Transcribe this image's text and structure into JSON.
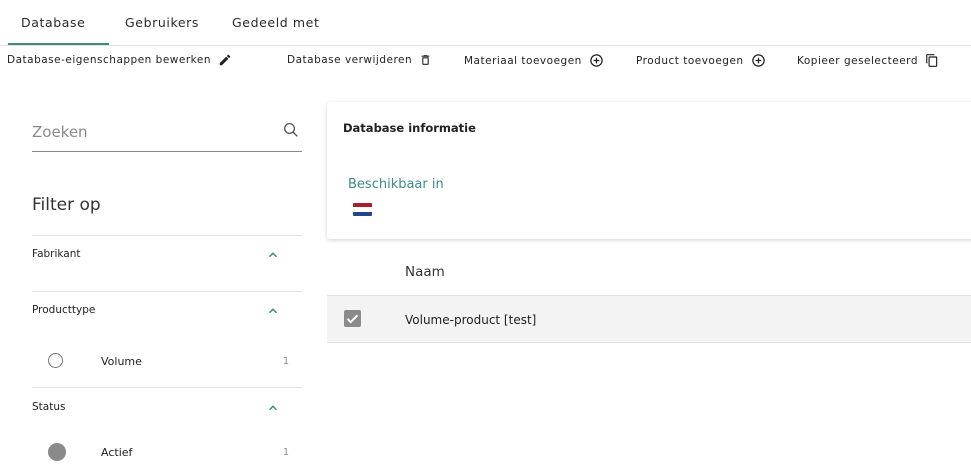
{
  "tabs": [
    {
      "label": "Database",
      "active": true
    },
    {
      "label": "Gebruikers",
      "active": false
    },
    {
      "label": "Gedeeld met",
      "active": false
    }
  ],
  "toolbar": {
    "edit_label": "Database-eigenschappen bewerken",
    "delete_label": "Database verwijderen",
    "add_material_label": "Materiaal toevoegen",
    "add_product_label": "Product toevoegen",
    "copy_label": "Kopieer geselecteerd"
  },
  "search": {
    "placeholder": "Zoeken"
  },
  "filters": {
    "title": "Filter op",
    "groups": [
      {
        "label": "Fabrikant",
        "options": []
      },
      {
        "label": "Producttype",
        "options": [
          {
            "label": "Volume",
            "count": "1",
            "selected": false
          }
        ]
      },
      {
        "label": "Status",
        "options": [
          {
            "label": "Actief",
            "count": "1",
            "selected": true
          }
        ]
      }
    ]
  },
  "info": {
    "title": "Database informatie",
    "available_label": "Beschikbaar in",
    "flag": "netherlands-flag-icon"
  },
  "table": {
    "columns": [
      "Naam"
    ],
    "rows": [
      {
        "name": "Volume-product [test]",
        "checked": true
      }
    ]
  },
  "colors": {
    "accent": "#3d8b85",
    "checkbox": "#8a8a8a"
  }
}
